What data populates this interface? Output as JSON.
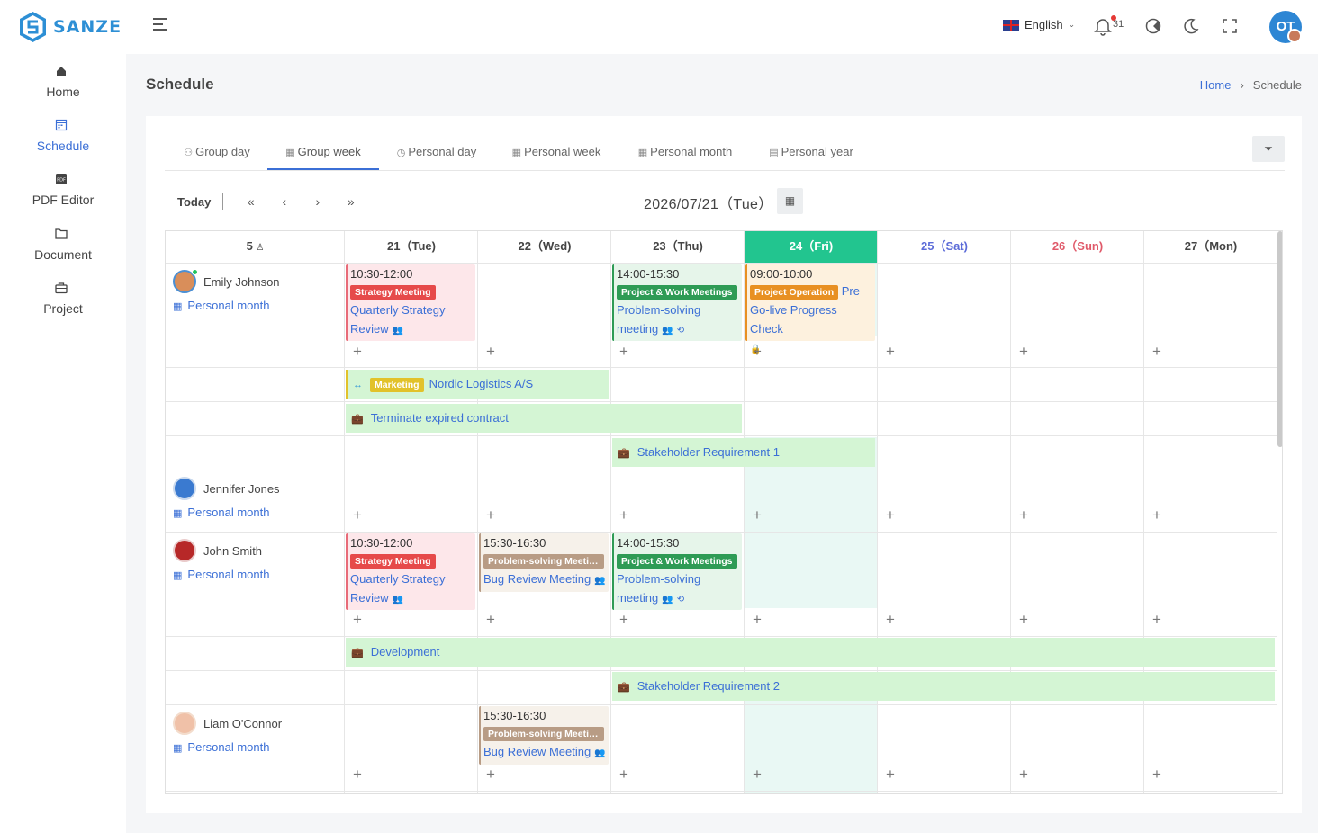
{
  "app": {
    "logo_text": "SANZE"
  },
  "sidebar": {
    "items": [
      {
        "label": "Home",
        "icon": "home-icon"
      },
      {
        "label": "Schedule",
        "icon": "calendar-icon"
      },
      {
        "label": "PDF Editor",
        "icon": "pdf-icon"
      },
      {
        "label": "Document",
        "icon": "folder-icon"
      },
      {
        "label": "Project",
        "icon": "briefcase-icon"
      }
    ]
  },
  "header": {
    "language": "English",
    "notification_count": "31",
    "user_initials": "OT"
  },
  "page": {
    "title": "Schedule",
    "breadcrumb_home": "Home",
    "breadcrumb_current": "Schedule"
  },
  "tabs": [
    "Group day",
    "Group week",
    "Personal day",
    "Personal week",
    "Personal month",
    "Personal year"
  ],
  "toolbar": {
    "today": "Today",
    "first": "«",
    "prev": "‹",
    "next": "›",
    "last": "»",
    "current_date": "2026/07/21（Tue）"
  },
  "grid": {
    "member_count": "5",
    "days": [
      {
        "label": "21（Tue)"
      },
      {
        "label": "22（Wed)"
      },
      {
        "label": "23（Thu)"
      },
      {
        "label": "24（Fri)"
      },
      {
        "label": "25（Sat)"
      },
      {
        "label": "26（Sun)"
      },
      {
        "label": "27（Mon)"
      }
    ]
  },
  "people": [
    {
      "name": "Emily Johnson",
      "link": "Personal month"
    },
    {
      "name": "Jennifer Jones",
      "link": "Personal month"
    },
    {
      "name": "John Smith",
      "link": "Personal month"
    },
    {
      "name": "Liam O'Connor",
      "link": "Personal month"
    }
  ],
  "events": {
    "ej_tue": {
      "time": "10:30-12:00",
      "tag": "Strategy Meeting",
      "title": "Quarterly Strategy Review"
    },
    "ej_thu": {
      "time": "14:00-15:30",
      "tag": "Project & Work Meetings",
      "title": "Problem-solving meeting"
    },
    "ej_fri": {
      "time": "09:00-10:00",
      "tag": "Project Operation",
      "title": "Pre Go-live Progress Check"
    },
    "js_tue": {
      "time": "10:30-12:00",
      "tag": "Strategy Meeting",
      "title": "Quarterly Strategy Review"
    },
    "js_wed": {
      "time": "15:30-16:30",
      "tag": "Problem-solving Meetin...",
      "title": "Bug Review Meeting"
    },
    "js_thu": {
      "time": "14:00-15:30",
      "tag": "Project & Work Meetings",
      "title": "Problem-solving meeting"
    },
    "lo_wed": {
      "time": "15:30-16:30",
      "tag": "Problem-solving Meetin...",
      "title": "Bug Review Meeting"
    }
  },
  "bars": {
    "marketing": {
      "tag": "Marketing",
      "title": "Nordic Logistics A/S"
    },
    "terminate": "Terminate expired contract",
    "stakeholder1": "Stakeholder Requirement 1",
    "development": "Development",
    "stakeholder2": "Stakeholder Requirement 2"
  },
  "colors": {
    "accent": "#3b6fd6",
    "today_header": "#22c58f",
    "strategy_tag": "#e64a4a",
    "project_tag": "#2e9b55",
    "operation_tag": "#e89022",
    "problem_tag": "#b89c85",
    "marketing_tag": "#e2c22a",
    "bar_bg": "#d4f5d4"
  }
}
